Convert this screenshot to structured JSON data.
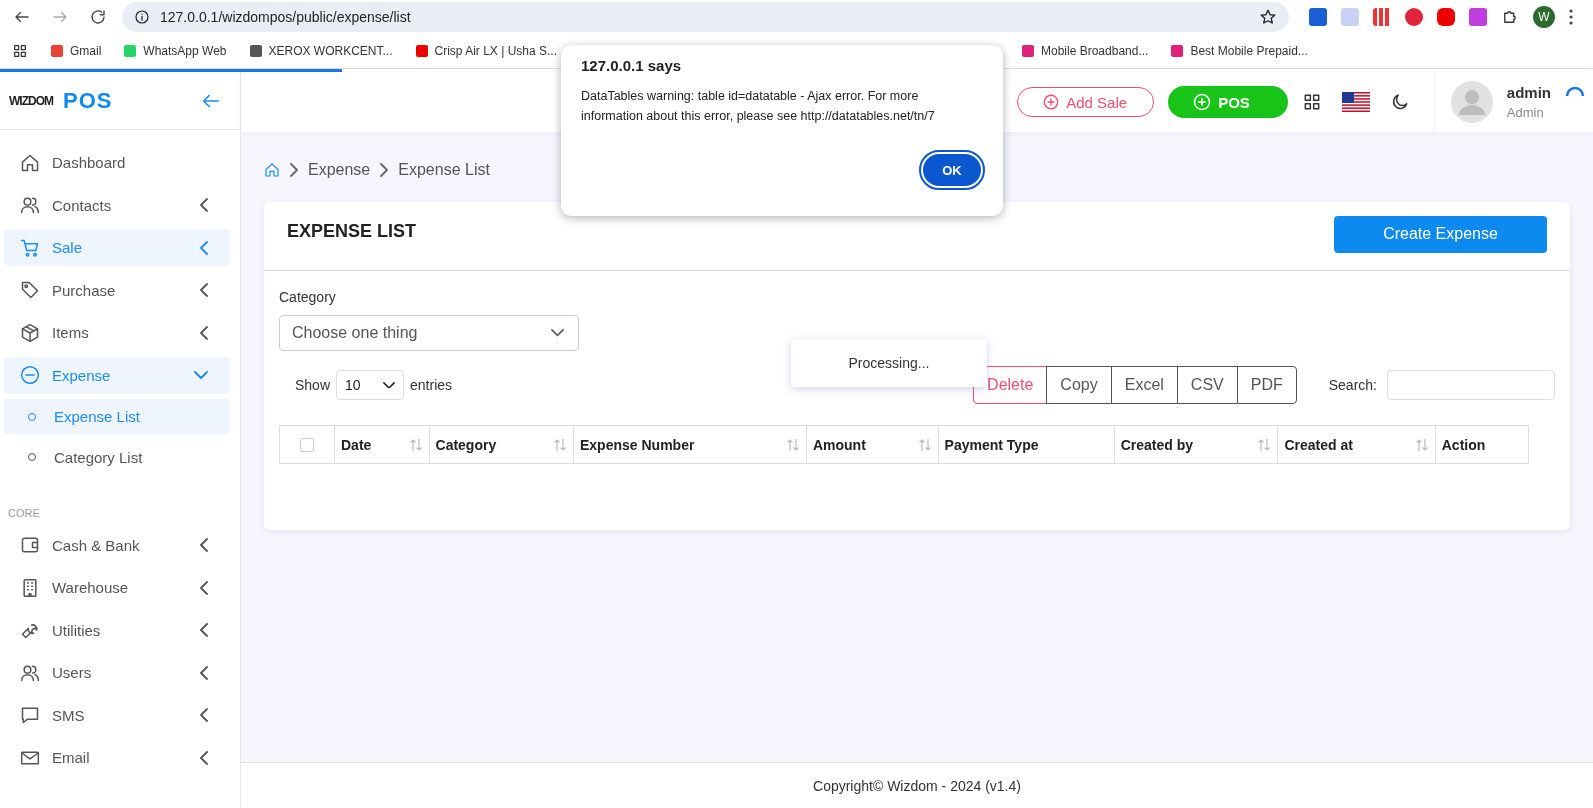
{
  "browser": {
    "url": "127.0.0.1/wizdompos/public/expense/list",
    "profile_initial": "W",
    "bookmarks": [
      {
        "label": "Gmail"
      },
      {
        "label": "WhatsApp Web"
      },
      {
        "label": "XEROX WORKCENT..."
      },
      {
        "label": "Crisp Air LX | Usha S..."
      },
      {
        "label": "Mobile Broadband..."
      },
      {
        "label": "Best Mobile Prepaid..."
      }
    ],
    "page_loading_bar": {
      "level": 0.215
    }
  },
  "sidebar": {
    "logo": "WIZDOM",
    "app_name": "POS",
    "items": [
      {
        "label": "Dashboard",
        "selected": false,
        "has_submenu": false
      },
      {
        "label": "Contacts",
        "selected": false,
        "expanded": false,
        "has_submenu": true
      },
      {
        "label": "Sale",
        "selected": true,
        "expanded": false,
        "has_submenu": true
      },
      {
        "label": "Purchase",
        "selected": false,
        "expanded": false,
        "has_submenu": true
      },
      {
        "label": "Items",
        "selected": false,
        "expanded": false,
        "has_submenu": true
      },
      {
        "label": "Expense",
        "selected": true,
        "expanded": true,
        "has_submenu": true,
        "children": [
          {
            "label": "Expense List",
            "selected": true
          },
          {
            "label": "Category List",
            "selected": false
          }
        ]
      }
    ],
    "section": "CORE",
    "core_items": [
      {
        "label": "Cash & Bank",
        "selected": false,
        "expanded": false,
        "has_submenu": true
      },
      {
        "label": "Warehouse",
        "selected": false,
        "expanded": false,
        "has_submenu": true
      },
      {
        "label": "Utilities",
        "selected": false,
        "expanded": false,
        "has_submenu": true
      },
      {
        "label": "Users",
        "selected": false,
        "expanded": false,
        "has_submenu": true
      },
      {
        "label": "SMS",
        "selected": false,
        "expanded": false,
        "has_submenu": true
      },
      {
        "label": "Email",
        "selected": false,
        "expanded": false,
        "has_submenu": true
      }
    ]
  },
  "header": {
    "add_sale": "Add Sale",
    "pos": "POS",
    "user_name": "admin",
    "user_role": "Admin"
  },
  "breadcrumb": [
    "Expense",
    "Expense List"
  ],
  "card": {
    "title": "EXPENSE LIST",
    "create_button": "Create Expense",
    "category_label": "Category",
    "category_placeholder": "Choose one thing",
    "show_label": "Show",
    "entries_value": "10",
    "entries_label": "entries",
    "export_buttons": [
      {
        "label": "Delete",
        "kind": "danger"
      },
      {
        "label": "Copy",
        "kind": "default"
      },
      {
        "label": "Excel",
        "kind": "default"
      },
      {
        "label": "CSV",
        "kind": "default"
      },
      {
        "label": "PDF",
        "kind": "default"
      }
    ],
    "search_label": "Search:",
    "select_all_checked": false,
    "columns": [
      {
        "label": "Date",
        "sortable": true
      },
      {
        "label": "Category",
        "sortable": true
      },
      {
        "label": "Expense Number",
        "sortable": true
      },
      {
        "label": "Amount",
        "sortable": true
      },
      {
        "label": "Payment Type",
        "sortable": false
      },
      {
        "label": "Created by",
        "sortable": true
      },
      {
        "label": "Created at",
        "sortable": true
      },
      {
        "label": "Action",
        "sortable": false
      }
    ],
    "processing": "Processing..."
  },
  "footer": "Copyright© Wizdom - 2024 (v1.4)",
  "dialog": {
    "title": "127.0.0.1 says",
    "message": "DataTables warning: table id=datatable - Ajax error. For more information about this error, please see http://datatables.net/tn/7",
    "ok": "OK"
  }
}
